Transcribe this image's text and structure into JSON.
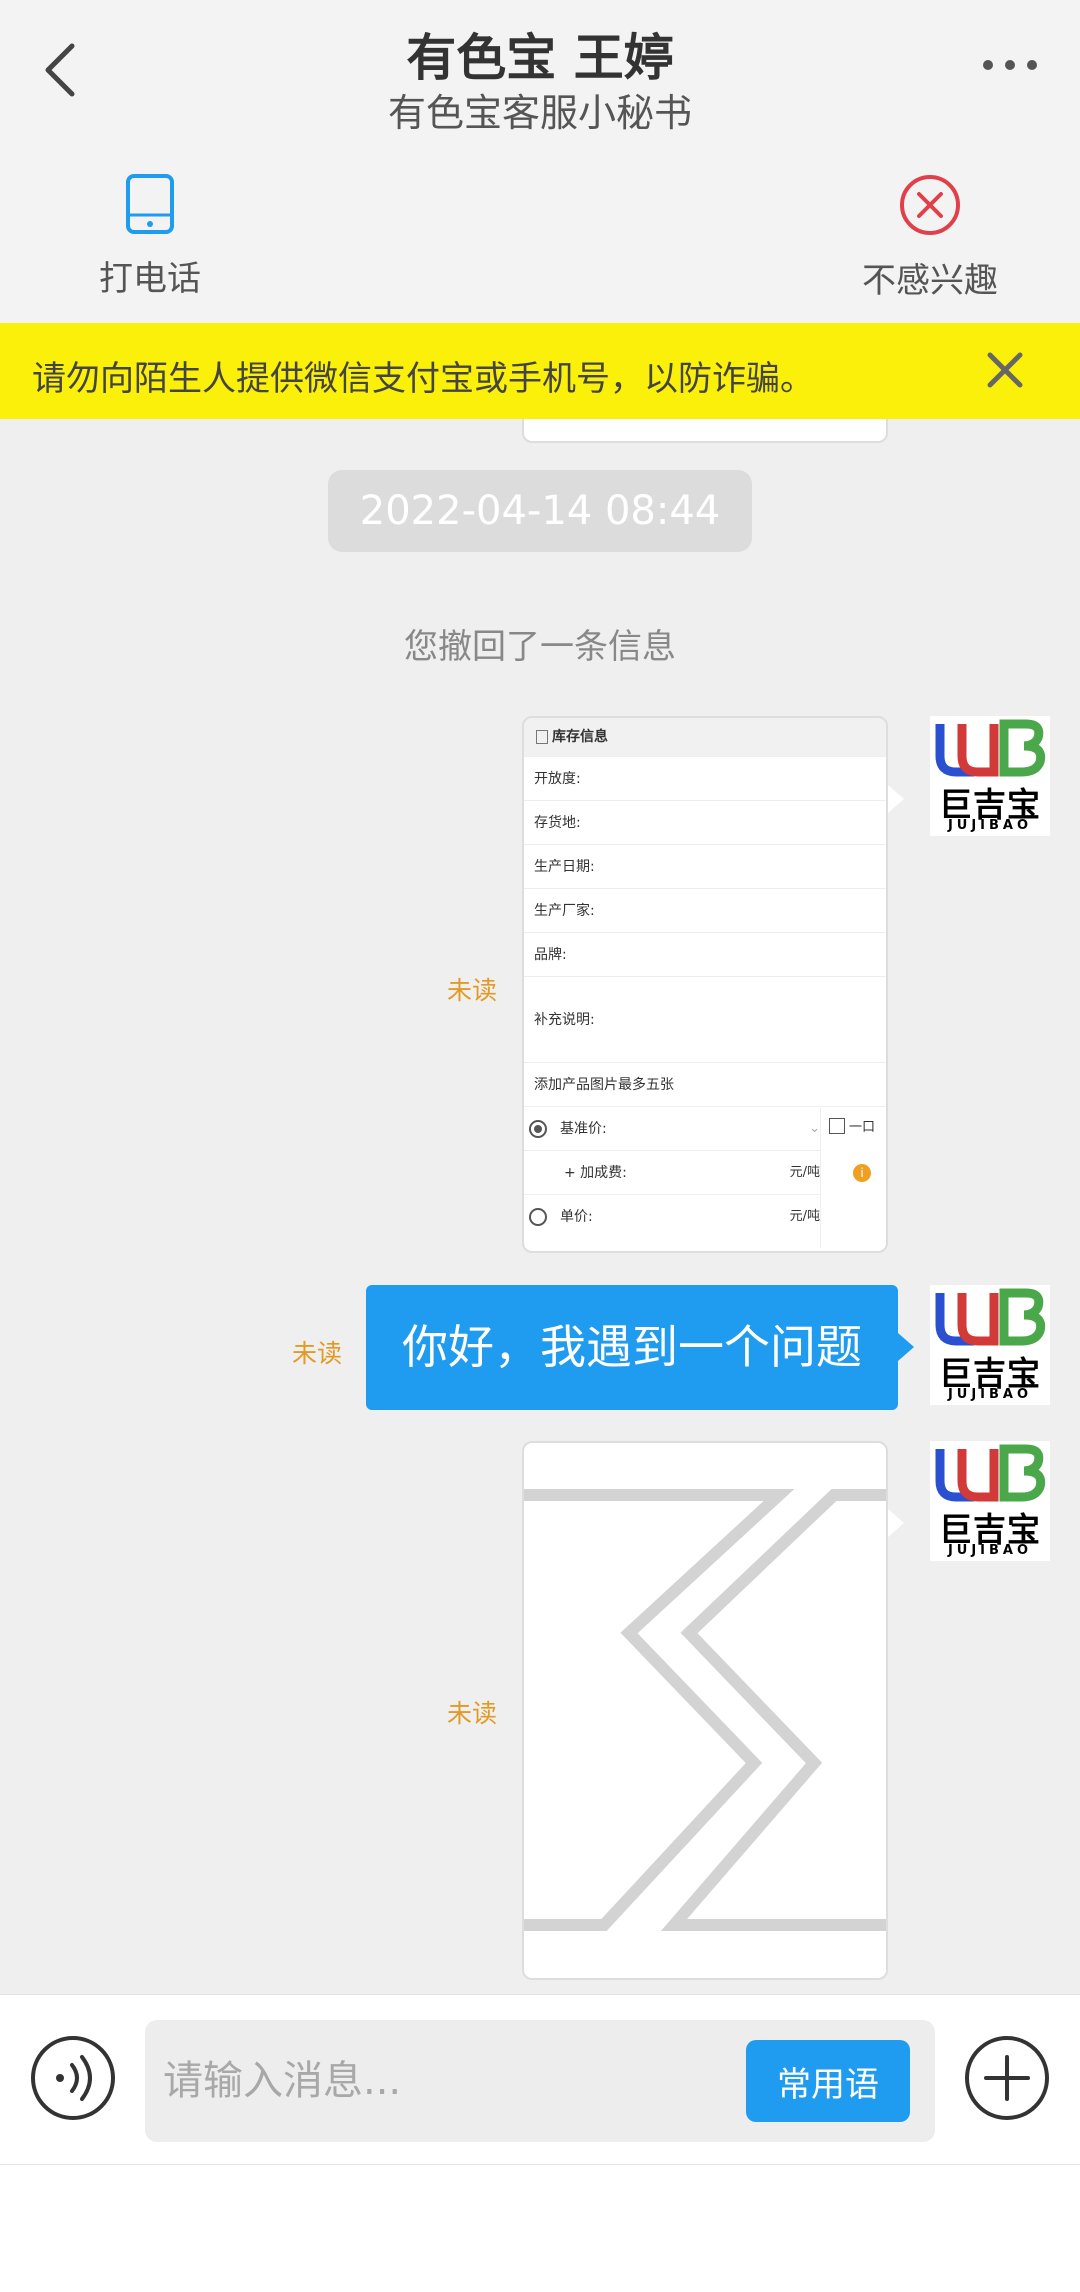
{
  "header": {
    "title": "有色宝 王婷",
    "subtitle": "有色宝客服小秘书"
  },
  "actions": {
    "call_label": "打电话",
    "not_interested_label": "不感兴趣"
  },
  "warning": {
    "text": "请勿向陌生人提供微信支付宝或手机号，以防诈骗。"
  },
  "chat": {
    "timestamp": "2022-04-14 08:44",
    "recall_notice": "您撤回了一条信息",
    "unread_label": "未读",
    "avatar_brand": "巨吉宝",
    "avatar_brand_sub": "JUJIBAO",
    "inventory_card": {
      "title": "库存信息",
      "rows": [
        "开放度:",
        "存货地:",
        "生产日期:",
        "生产厂家:",
        "品牌:"
      ],
      "note_label": "补充说明:",
      "photos_label": "添加产品图片最多五张",
      "base_price_label": "基准价:",
      "surcharge_label": "+ 加成费:",
      "unit_price_label": "单价:",
      "unit": "元/吨",
      "side_check_label": "一口"
    },
    "text_message": "你好，我遇到一个问题"
  },
  "composer": {
    "placeholder": "请输入消息...",
    "phrases_button": "常用语"
  },
  "colors": {
    "accent": "#1f9bf0",
    "warning_bg": "#fbf00a",
    "unread": "#e29a25",
    "danger": "#e0404a"
  }
}
